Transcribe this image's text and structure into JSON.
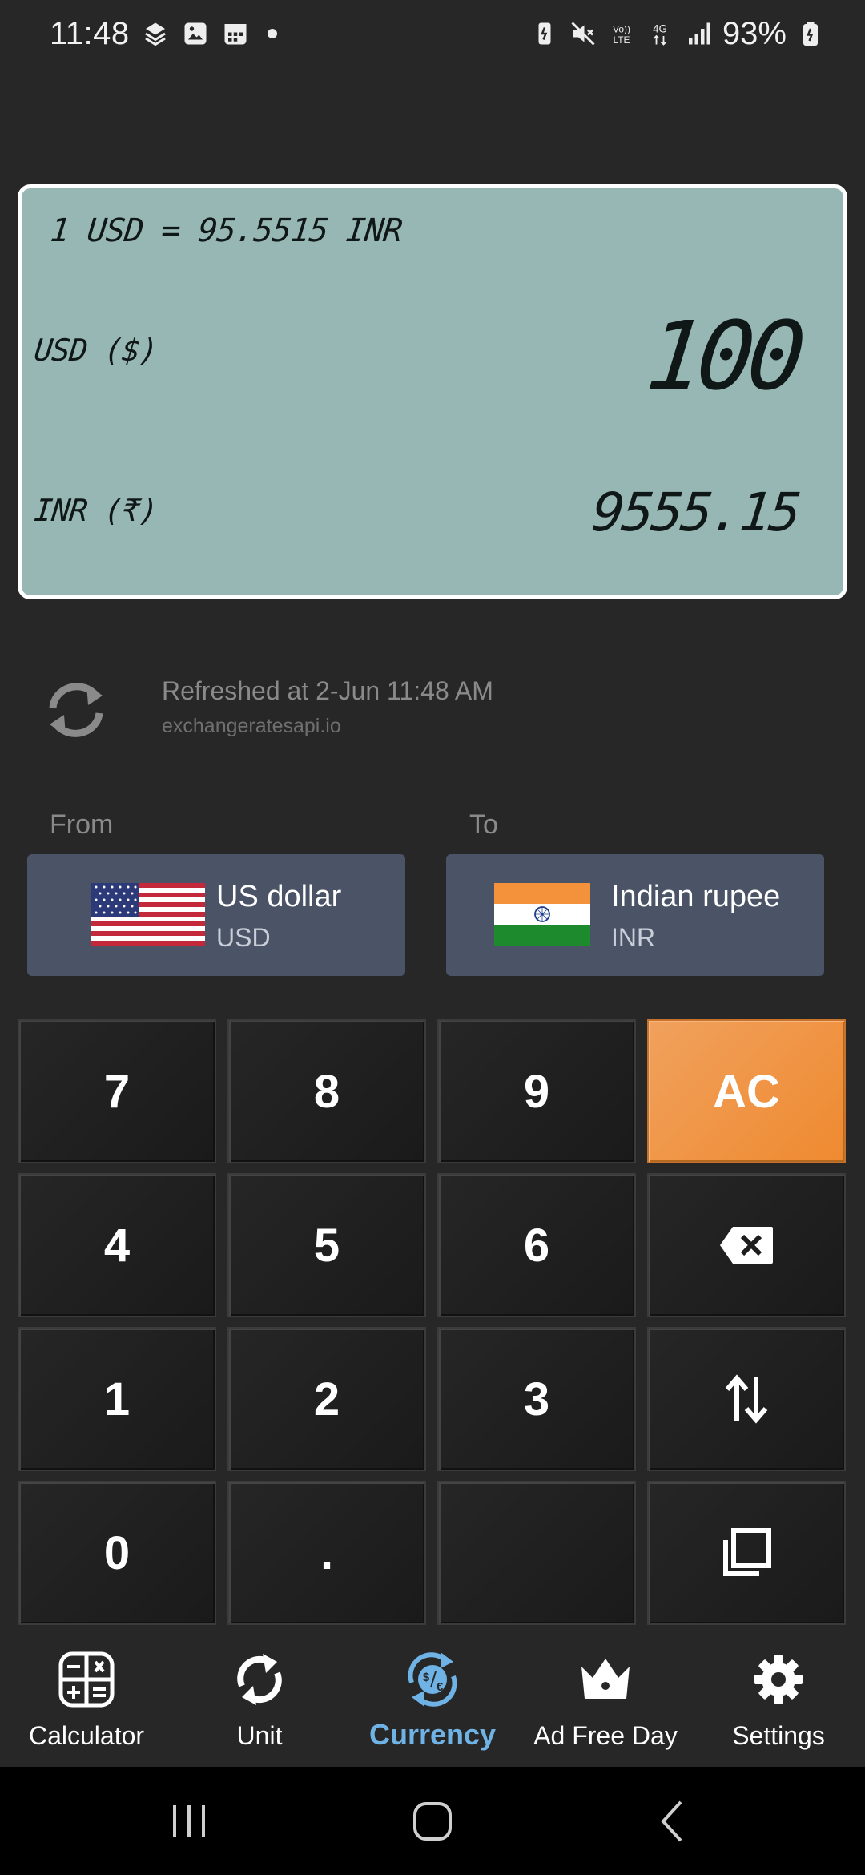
{
  "status_bar": {
    "time": "11:48",
    "battery": "93%",
    "left_icons": [
      "stack-icon",
      "gallery-icon",
      "calendar-icon",
      "dot-icon"
    ],
    "right_icons": [
      "battery-saver-icon",
      "mute-icon",
      "volte-icon",
      "4g-icon",
      "signal-icon",
      "battery-icon"
    ]
  },
  "display": {
    "rate_text": "1 USD = 95.5515 INR",
    "from_label": "USD ($)",
    "from_value": "100",
    "to_label": "INR (₹)",
    "to_value": "9555.15"
  },
  "refresh": {
    "text": "Refreshed at 2-Jun 11:48 AM",
    "source": "exchangeratesapi.io"
  },
  "selectors": {
    "from_label": "From",
    "to_label": "To",
    "from": {
      "name": "US dollar",
      "code": "USD",
      "flag": "us-flag-icon"
    },
    "to": {
      "name": "Indian rupee",
      "code": "INR",
      "flag": "india-flag-icon"
    }
  },
  "keypad": {
    "row1": [
      "7",
      "8",
      "9",
      "AC"
    ],
    "row2": [
      "4",
      "5",
      "6"
    ],
    "row3": [
      "1",
      "2",
      "3"
    ],
    "row4": [
      "0",
      "."
    ],
    "icons": [
      "backspace-icon",
      "swap-icon",
      "copy-icon"
    ],
    "ac_color": "#ef8a30"
  },
  "nav": {
    "items": [
      {
        "label": "Calculator",
        "icon": "calculator-icon"
      },
      {
        "label": "Unit",
        "icon": "unit-icon"
      },
      {
        "label": "Currency",
        "icon": "currency-icon"
      },
      {
        "label": "Ad Free Day",
        "icon": "crown-icon"
      },
      {
        "label": "Settings",
        "icon": "gear-icon"
      }
    ],
    "active": "Currency",
    "active_color": "#6fb3e6"
  },
  "system_nav": [
    "recents-icon",
    "home-icon",
    "back-icon"
  ]
}
